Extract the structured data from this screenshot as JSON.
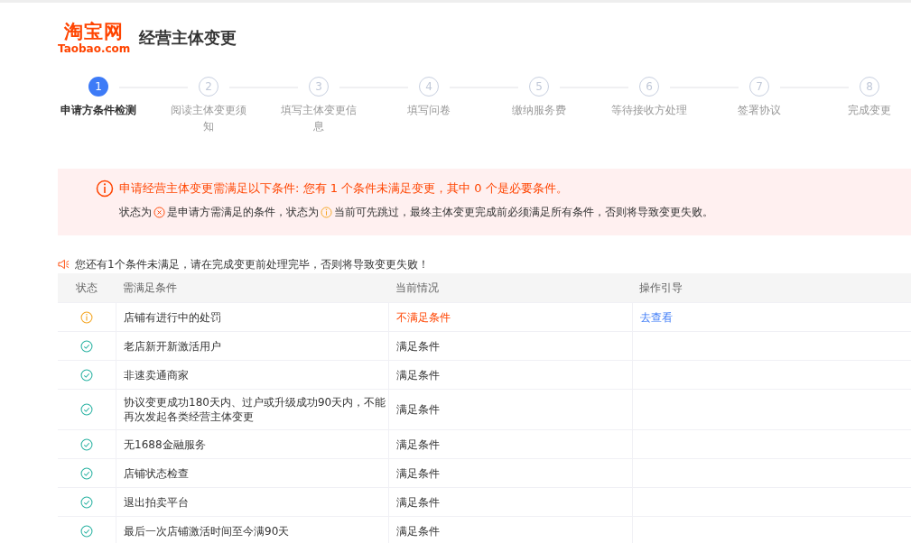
{
  "header": {
    "logo_main": "淘宝网",
    "logo_sub": "Taobao.com",
    "title": "经营主体变更"
  },
  "steps": [
    {
      "number": "1",
      "label": "申请方条件检测",
      "selected": true
    },
    {
      "number": "2",
      "label": "阅读主体变更须知",
      "selected": false
    },
    {
      "number": "3",
      "label": "填写主体变更信息",
      "selected": false
    },
    {
      "number": "4",
      "label": "填写问卷",
      "selected": false
    },
    {
      "number": "5",
      "label": "缴纳服务费",
      "selected": false
    },
    {
      "number": "6",
      "label": "等待接收方处理",
      "selected": false
    },
    {
      "number": "7",
      "label": "签署协议",
      "selected": false
    },
    {
      "number": "8",
      "label": "完成变更",
      "selected": false
    }
  ],
  "notice": {
    "title": "申请经营主体变更需满足以下条件: 您有 1 个条件未满足变更，其中 0 个是必要条件。",
    "legend": [
      {
        "kind": "text",
        "text": "状态为"
      },
      {
        "kind": "error"
      },
      {
        "kind": "text",
        "text": "是申请方需满足的条件，状态为"
      },
      {
        "kind": "warning"
      },
      {
        "kind": "text",
        "text": "当前可先跳过，最终主体变更完成前必须满足所有条件，否则将导致变更失败。"
      }
    ]
  },
  "warning_line": "您还有1个条件未满足，请在完成变更前处理完毕，否则将导致变更失败！",
  "table": {
    "columns": [
      "状态",
      "需满足条件",
      "当前情况",
      "操作引导"
    ],
    "rows": [
      {
        "kind": "warning",
        "condition": "店铺有进行中的处罚",
        "current": "不满足条件",
        "met": false,
        "action": "去查看"
      },
      {
        "kind": "ok",
        "condition": "老店新开新激活用户",
        "current": "满足条件",
        "met": true
      },
      {
        "kind": "ok",
        "condition": "非速卖通商家",
        "current": "满足条件",
        "met": true
      },
      {
        "kind": "ok",
        "condition": "协议变更成功180天内、过户或升级成功90天内，不能再次发起各类经营主体变更",
        "current": "满足条件",
        "met": true
      },
      {
        "kind": "ok",
        "condition": "无1688金融服务",
        "current": "满足条件",
        "met": true
      },
      {
        "kind": "ok",
        "condition": "店铺状态检查",
        "current": "满足条件",
        "met": true
      },
      {
        "kind": "ok",
        "condition": "退出拍卖平台",
        "current": "满足条件",
        "met": true
      },
      {
        "kind": "ok",
        "condition": "最后一次店铺激活时间至今满90天",
        "current": "满足条件",
        "met": true
      }
    ]
  }
}
